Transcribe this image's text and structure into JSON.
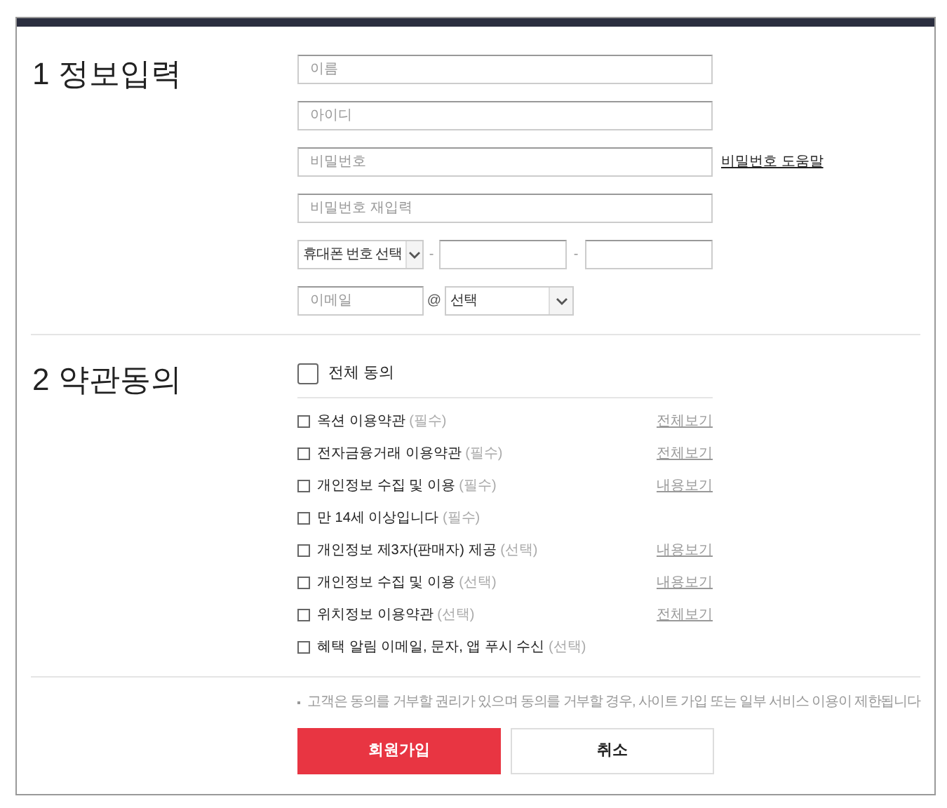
{
  "sections": [
    {
      "number": "1",
      "title": "정보입력"
    },
    {
      "number": "2",
      "title": "약관동의"
    }
  ],
  "fields": {
    "name": {
      "placeholder": "이름"
    },
    "id": {
      "placeholder": "아이디"
    },
    "password": {
      "placeholder": "비밀번호"
    },
    "password_help": "비밀번호 도움말",
    "password_confirm": {
      "placeholder": "비밀번호 재입력"
    },
    "phone": {
      "select": "휴대폰 번호 선택",
      "separator_1": "-",
      "separator_2": "-"
    },
    "email": {
      "placeholder": "이메일",
      "at": "@",
      "domain_select": "선택"
    }
  },
  "agree_all": {
    "label": "전체 동의",
    "checked": false
  },
  "terms": [
    {
      "label": "옥션 이용약관",
      "tag": "(필수)",
      "checked": false,
      "link": "전체보기"
    },
    {
      "label": "전자금융거래 이용약관",
      "tag": "(필수)",
      "checked": false,
      "link": "전체보기"
    },
    {
      "label": "개인정보 수집 및 이용",
      "tag": "(필수)",
      "checked": false,
      "link": "내용보기"
    },
    {
      "label": "만 14세 이상입니다",
      "tag": "(필수)",
      "checked": false
    },
    {
      "label": "개인정보 제3자(판매자) 제공",
      "tag": "(선택)",
      "checked": false,
      "link": "내용보기"
    },
    {
      "label": "개인정보 수집 및 이용",
      "tag": "(선택)",
      "checked": false,
      "link": "내용보기"
    },
    {
      "label": "위치정보 이용약관",
      "tag": "(선택)",
      "checked": false,
      "link": "전체보기"
    },
    {
      "label": "혜택 알림 이메일, 문자, 앱 푸시 수신",
      "tag": "(선택)",
      "checked": false
    }
  ],
  "notice": "고객은 동의를 거부할 권리가 있으며 동의를 거부할 경우, 사이트 가입 또는 일부 서비스 이용이 제한됩니다",
  "buttons": {
    "submit": "회원가입",
    "cancel": "취소"
  }
}
